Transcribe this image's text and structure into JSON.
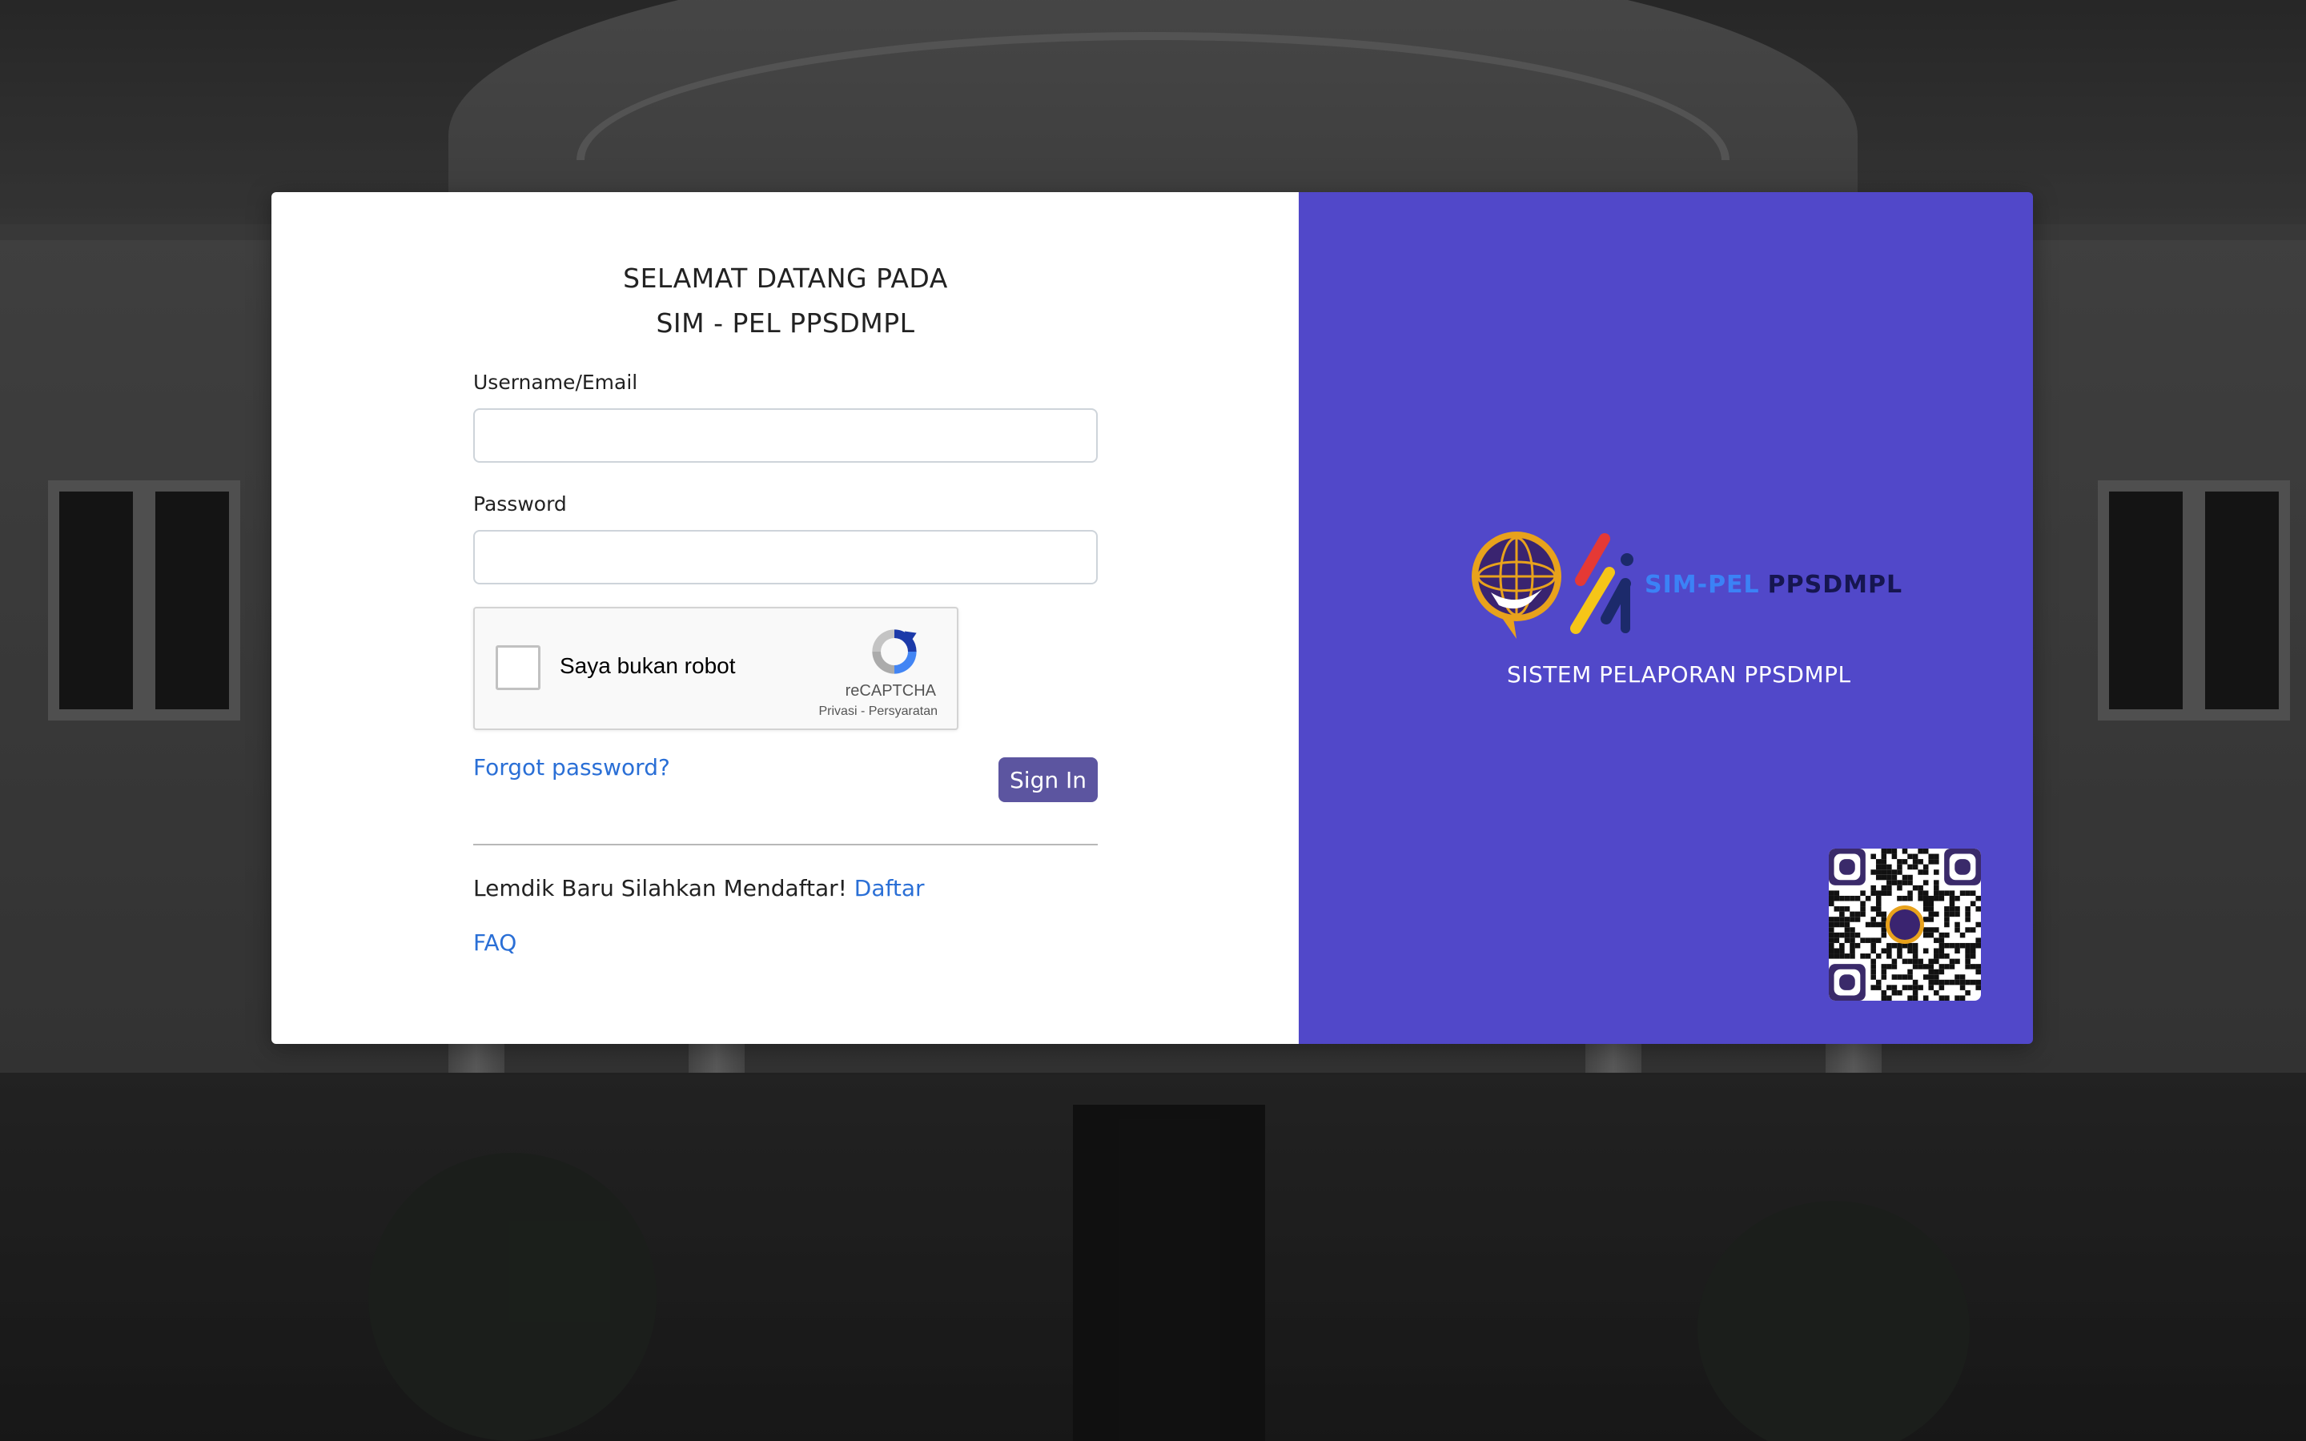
{
  "welcome": {
    "line1": "SELAMAT DATANG PADA",
    "line2": "SIM - PEL PPSDMPL"
  },
  "form": {
    "username_label": "Username/Email",
    "username_value": "",
    "password_label": "Password",
    "password_value": "",
    "captcha_text": "Saya bukan robot",
    "captcha_brand": "reCAPTCHA",
    "captcha_terms": "Privasi - Persyaratan",
    "forgot_label": "Forgot password?",
    "signin_label": "Sign In",
    "register_text": "Lemdik Baru Silahkan Mendaftar!",
    "register_link": "Daftar",
    "faq_label": "FAQ"
  },
  "panel": {
    "app_name_part1": "SIM-PEL",
    "app_name_part2": "PPSDMPL",
    "subtitle": "SISTEM PELAPORAN PPSDMPL",
    "icons": {
      "emblem": "ministry-emblem-icon",
      "mark": "sim-pel-mark-icon",
      "qr": "qr-code-icon"
    }
  },
  "colors": {
    "panel_bg": "#5148c9",
    "link": "#2a6fd6",
    "button_bg": "#5c55a0",
    "brand_blue": "#3b82f6",
    "brand_navy": "#161650"
  }
}
